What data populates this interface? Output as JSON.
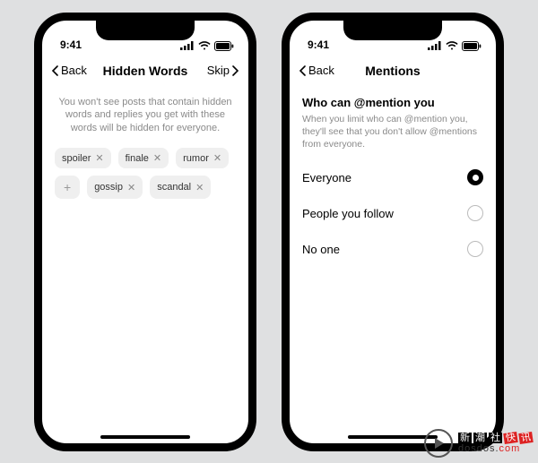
{
  "statusbar": {
    "time": "9:41"
  },
  "phone1": {
    "back": "Back",
    "title": "Hidden Words",
    "skip": "Skip",
    "description": "You won't see posts that contain hidden words and replies you get with these words will be hidden for everyone.",
    "chips": [
      "spoiler",
      "finale",
      "rumor",
      "gossip",
      "scandal"
    ]
  },
  "phone2": {
    "back": "Back",
    "title": "Mentions",
    "section_title": "Who can @mention you",
    "section_desc": "When you limit who can @mention you, they'll see that you don't allow @mentions from everyone.",
    "options": [
      {
        "label": "Everyone",
        "selected": true
      },
      {
        "label": "People you follow",
        "selected": false
      },
      {
        "label": "No one",
        "selected": false
      }
    ]
  },
  "watermark": {
    "cn": "新潮社快讯",
    "url_1": "dosdos.",
    "url_2": "com"
  }
}
